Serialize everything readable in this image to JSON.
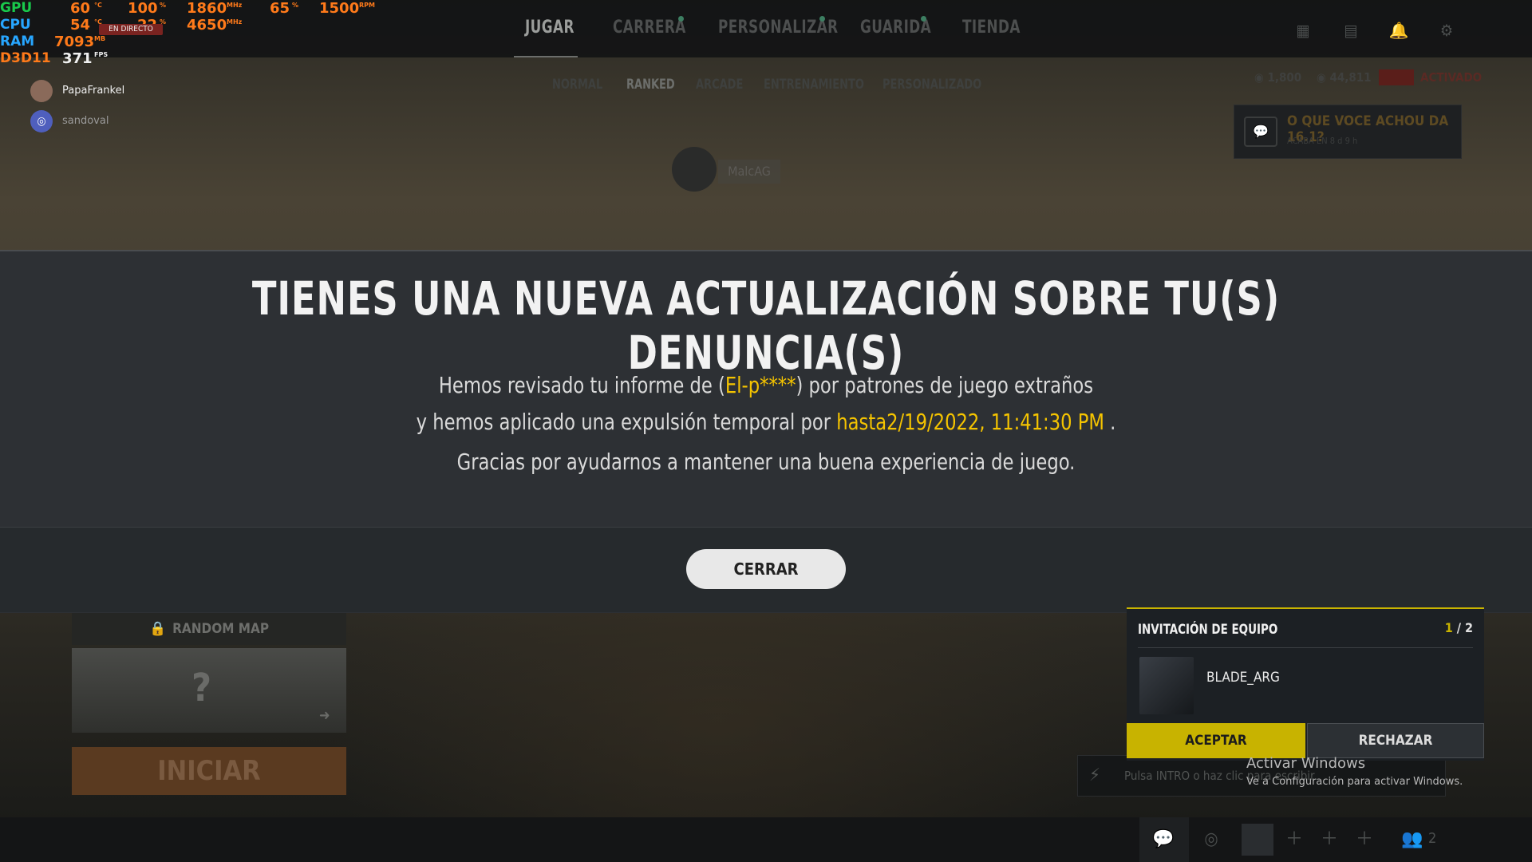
{
  "hud": {
    "gpu": {
      "label": "GPU",
      "temp": "60",
      "temp_unit": "°C",
      "load": "100",
      "load_unit": "%",
      "clock": "1860",
      "clock_unit": "MHz",
      "fan": "65",
      "fan_unit": "%",
      "rpm": "1500",
      "rpm_unit": "RPM"
    },
    "cpu": {
      "label": "CPU",
      "temp": "54",
      "temp_unit": "°C",
      "load": "22",
      "load_unit": "%",
      "clock": "4650",
      "clock_unit": "MHz"
    },
    "ram": {
      "label": "RAM",
      "value": "7093",
      "unit": "MB"
    },
    "d3d": {
      "label": "D3D11",
      "value": "371",
      "unit": "FPS"
    },
    "colors": {
      "gpu": "#19c94b",
      "cpu": "#27a6ff",
      "ram": "#27a6ff",
      "d3d": "#ff7a1a"
    }
  },
  "live_badge": "EN DIRECTO",
  "stream_users": [
    {
      "name": "PapaFrankel"
    },
    {
      "name": "sandoval"
    }
  ],
  "nav": {
    "tabs": [
      {
        "label": "JUGAR",
        "active": true
      },
      {
        "label": "CARRERA",
        "active": false
      },
      {
        "label": "PERSONALIZAR",
        "active": false
      },
      {
        "label": "GUARIDA",
        "active": false
      },
      {
        "label": "TIENDA",
        "active": false
      }
    ],
    "subtabs": [
      {
        "label": "NORMAL",
        "active": false
      },
      {
        "label": "RANKED",
        "active": true
      },
      {
        "label": "ARCADE",
        "active": false
      },
      {
        "label": "ENTRENAMIENTO",
        "active": false
      },
      {
        "label": "PERSONALIZADO",
        "active": false
      }
    ],
    "currency_1": "1,800",
    "currency_2": "44,811",
    "status": "ACTIVADO"
  },
  "survey": {
    "title": "O QUE VOCE ACHOU DA 16.1?",
    "subtitle": "ACABA EN 8 d 9 h"
  },
  "player_name": "MalcAG",
  "modal": {
    "title": "TIENES UNA NUEVA ACTUALIZACIÓN SOBRE TU(S) DENUNCIA(S)",
    "line1_a": "Hemos revisado tu informe de (",
    "line1_name": "El-p****",
    "line1_b": ") por patrones de juego extraños",
    "line2_a": "y hemos aplicado una expulsión temporal por ",
    "line2_date": "hasta2/19/2022, 11:41:30 PM",
    "line2_b": " .",
    "line3": "Gracias por ayudarnos a mantener una buena experiencia de juego.",
    "close_label": "CERRAR",
    "highlight_color": "#f5c400"
  },
  "lobby": {
    "random_map": "RANDOM MAP",
    "start": "INICIAR"
  },
  "invite": {
    "title": "INVITACIÓN DE EQUIPO",
    "count_current": "1",
    "count_total": "2",
    "player": "BLADE_ARG",
    "accept": "ACEPTAR",
    "reject": "RECHAZAR",
    "accent": "#c8b300"
  },
  "chat": {
    "hint": "Pulsa INTRO o haz clic para escribir"
  },
  "windows_activation": {
    "line1": "Activar Windows",
    "line2": "Ve a Configuración para activar Windows."
  },
  "friends_count": "2"
}
